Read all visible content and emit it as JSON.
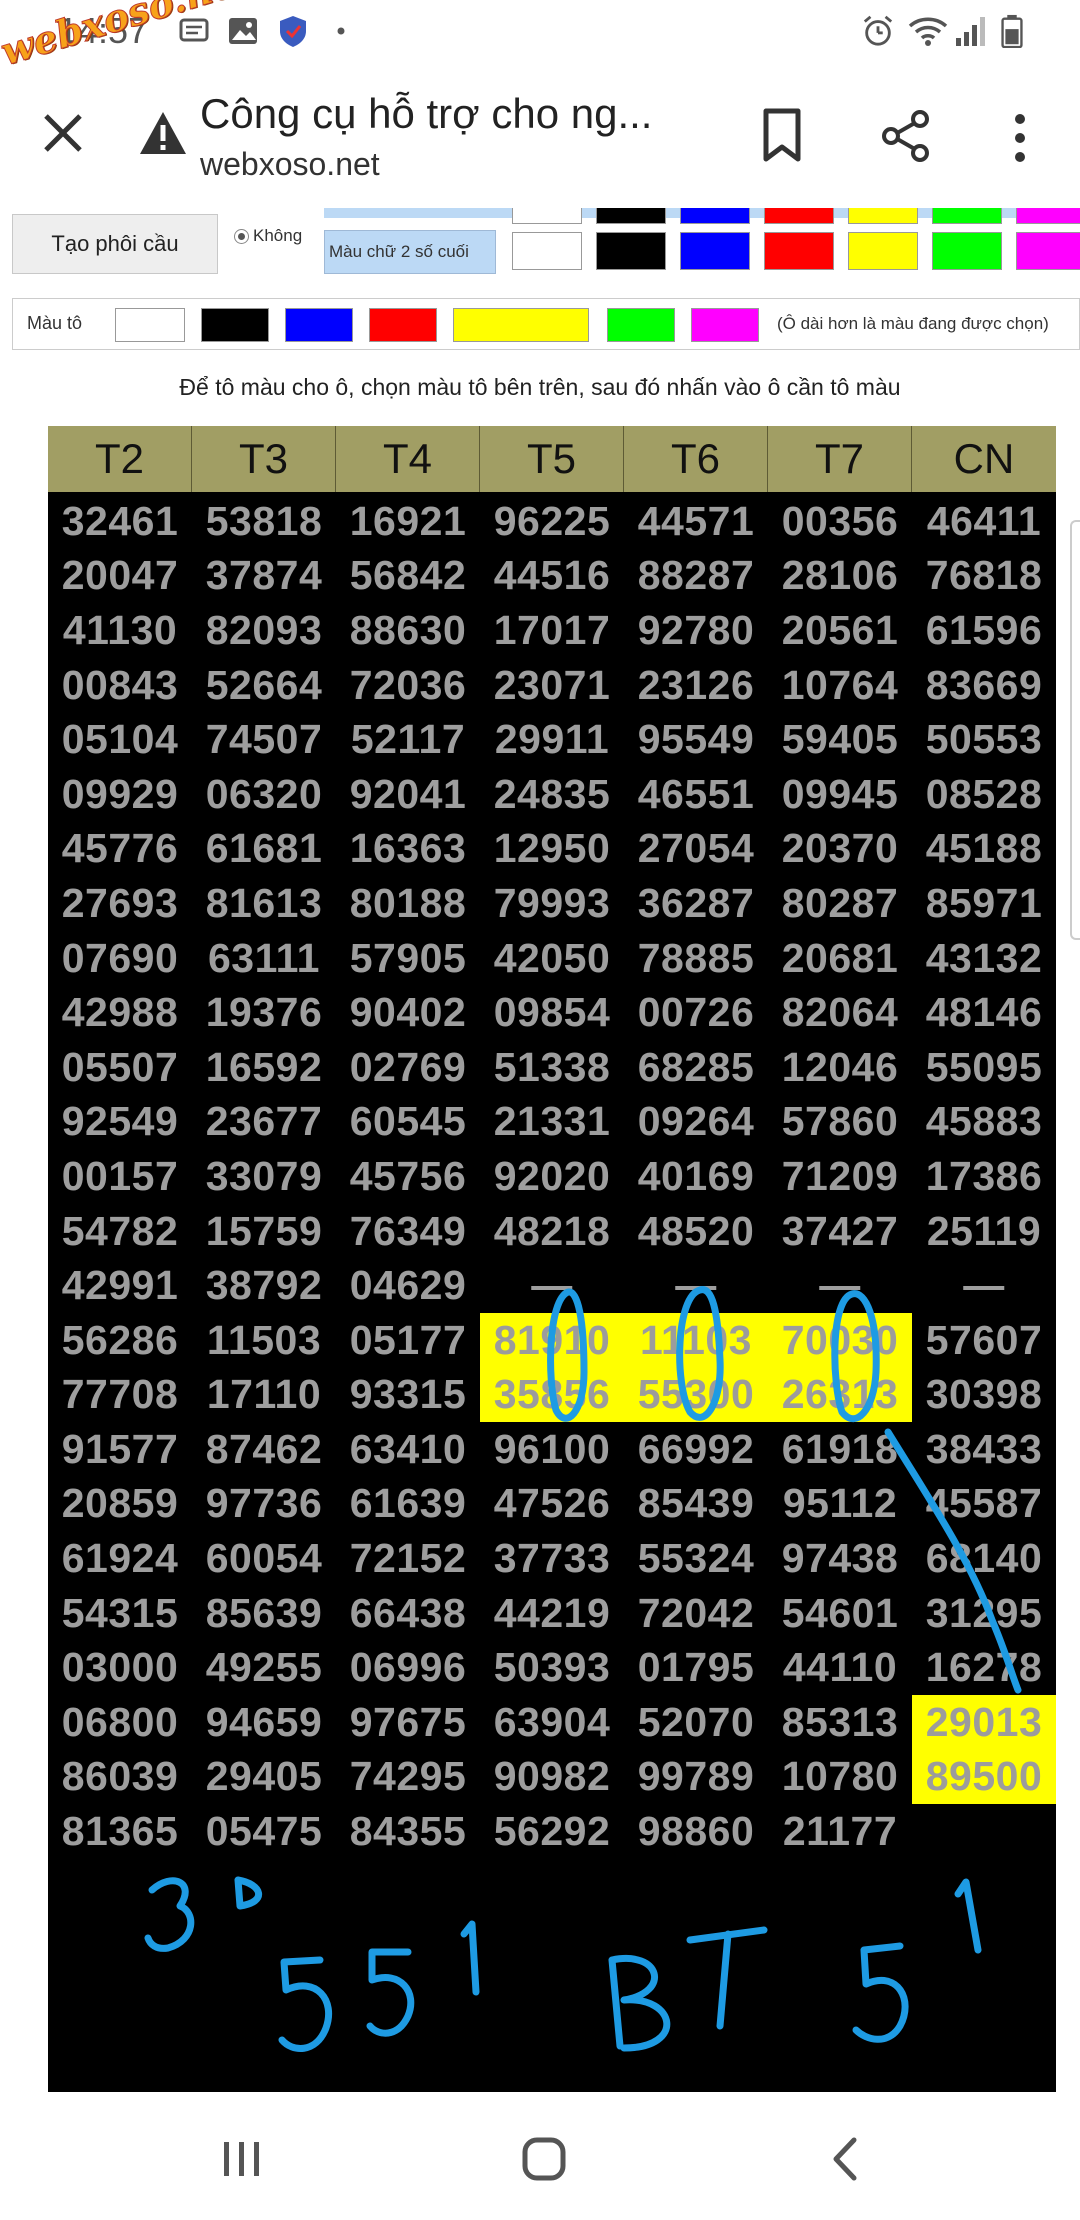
{
  "status_bar": {
    "time": "14:57",
    "watermark": "webxoso.net",
    "icons": [
      "chat-icon",
      "gallery-icon",
      "shield-icon",
      "dot-icon",
      "alarm-icon",
      "wifi-icon",
      "signal-icon",
      "battery-icon"
    ]
  },
  "browser": {
    "title": "Công cụ hỗ trợ cho ng...",
    "url": "webxoso.net",
    "icons": [
      "close-icon",
      "warning-icon",
      "bookmark-icon",
      "share-icon",
      "more-vert-icon"
    ]
  },
  "settings": {
    "create_button": "Tạo phôi cầu",
    "radio_option": "Không",
    "last2_color_label": "Màu chữ 2 số cuối",
    "paint_label": "Màu tô",
    "paint_hint": "(Ô dài hơn là màu đang được chọn)",
    "colors": [
      "#ffffff",
      "#000000",
      "#0000ff",
      "#ff0000",
      "#ffff00",
      "#00ff00",
      "#ff00ff"
    ]
  },
  "instruction": "Để tô màu cho ô, chọn màu tô bên trên, sau đó nhấn vào ô cần tô màu",
  "table": {
    "headers": [
      "T2",
      "T3",
      "T4",
      "T5",
      "T6",
      "T7",
      "CN"
    ],
    "header_color": "#a19e64",
    "highlight_color": "#ffff00",
    "rows": [
      [
        "32461",
        "53818",
        "16921",
        "96225",
        "44571",
        "00356",
        "46411"
      ],
      [
        "20047",
        "37874",
        "56842",
        "44516",
        "88287",
        "28106",
        "76818"
      ],
      [
        "41130",
        "82093",
        "88630",
        "17017",
        "92780",
        "20561",
        "61596"
      ],
      [
        "00843",
        "52664",
        "72036",
        "23071",
        "23126",
        "10764",
        "83669"
      ],
      [
        "05104",
        "74507",
        "52117",
        "29911",
        "95549",
        "59405",
        "50553"
      ],
      [
        "09929",
        "06320",
        "92041",
        "24835",
        "46551",
        "09945",
        "08528"
      ],
      [
        "45776",
        "61681",
        "16363",
        "12950",
        "27054",
        "20370",
        "45188"
      ],
      [
        "27693",
        "81613",
        "80188",
        "79993",
        "36287",
        "80287",
        "85971"
      ],
      [
        "07690",
        "63111",
        "57905",
        "42050",
        "78885",
        "20681",
        "43132"
      ],
      [
        "42988",
        "19376",
        "90402",
        "09854",
        "00726",
        "82064",
        "48146"
      ],
      [
        "05507",
        "16592",
        "02769",
        "51338",
        "68285",
        "12046",
        "55095"
      ],
      [
        "92549",
        "23677",
        "60545",
        "21331",
        "09264",
        "57860",
        "45883"
      ],
      [
        "00157",
        "33079",
        "45756",
        "92020",
        "40169",
        "71209",
        "17386"
      ],
      [
        "54782",
        "15759",
        "76349",
        "48218",
        "48520",
        "37427",
        "25119"
      ],
      [
        "42991",
        "38792",
        "04629",
        "—",
        "—",
        "—",
        "—"
      ],
      [
        "56286",
        "11503",
        "05177",
        "81910",
        "11103",
        "70030",
        "57607"
      ],
      [
        "77708",
        "17110",
        "93315",
        "35856",
        "55300",
        "26313",
        "30398"
      ],
      [
        "91577",
        "87462",
        "63410",
        "96100",
        "66992",
        "61918",
        "38433"
      ],
      [
        "20859",
        "97736",
        "61639",
        "47526",
        "85439",
        "95112",
        "45587"
      ],
      [
        "61924",
        "60054",
        "72152",
        "37733",
        "55324",
        "97438",
        "68140"
      ],
      [
        "54315",
        "85639",
        "66438",
        "44219",
        "72042",
        "54601",
        "31295"
      ],
      [
        "03000",
        "49255",
        "06996",
        "50393",
        "01795",
        "44110",
        "16278"
      ],
      [
        "06800",
        "94659",
        "97675",
        "63904",
        "52070",
        "85313",
        "29013"
      ],
      [
        "86039",
        "29405",
        "74295",
        "90982",
        "99789",
        "10780",
        "89500"
      ],
      [
        "81365",
        "05475",
        "84355",
        "56292",
        "98860",
        "21177",
        ""
      ]
    ],
    "highlighted_cells": [
      [
        15,
        3
      ],
      [
        15,
        4
      ],
      [
        15,
        5
      ],
      [
        16,
        3
      ],
      [
        16,
        4
      ],
      [
        16,
        5
      ],
      [
        22,
        6
      ],
      [
        23,
        6
      ]
    ]
  },
  "handwriting": {
    "ink_color": "#1e9be3",
    "notes": [
      "3D",
      "551",
      "BT",
      "51"
    ]
  },
  "nav_bar": {
    "icons": [
      "recents-icon",
      "home-icon",
      "back-icon"
    ]
  }
}
